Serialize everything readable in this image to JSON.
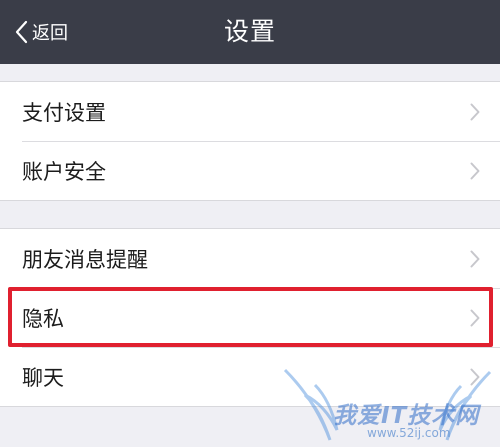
{
  "nav": {
    "back_label": "返回",
    "title": "设置"
  },
  "groups": [
    {
      "items": [
        {
          "label": "支付设置"
        },
        {
          "label": "账户安全"
        }
      ]
    },
    {
      "items": [
        {
          "label": "朋友消息提醒"
        },
        {
          "label": "隐私"
        },
        {
          "label": "聊天"
        }
      ]
    }
  ],
  "highlight": {
    "item": "隐私",
    "color": "#e0202f"
  },
  "watermark": {
    "text": "我爱IT技术网",
    "url": "www.52ij.com"
  },
  "colors": {
    "navbar": "#3a3d48",
    "background": "#efeff4",
    "chevron": "#c7c7cc"
  }
}
